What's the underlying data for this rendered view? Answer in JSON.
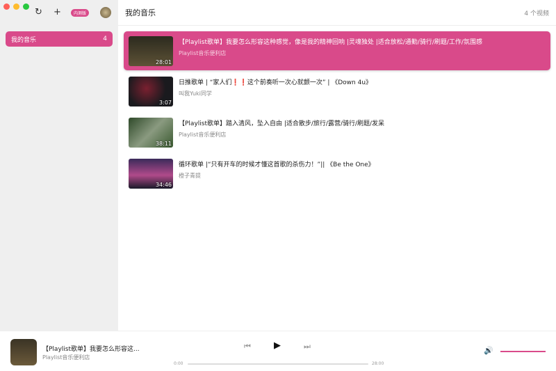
{
  "toolbar": {
    "badge": "内测版",
    "refresh_icon": "↻",
    "add_icon": "+",
    "avatar_icon": "🐱"
  },
  "sidebar": {
    "items": [
      {
        "label": "我的音乐",
        "count": "4"
      }
    ]
  },
  "header": {
    "title": "我的音乐",
    "count": "4 个视频"
  },
  "videos": [
    {
      "title": "【Playlist歌单】我要怎么形容这种感觉，像是我的精神回响 |灵魂独处 |适合放松/通勤/骑行/刷题/工作/氛围感",
      "channel": "Playlist音乐便利店",
      "duration": "28:01",
      "selected": true
    },
    {
      "title": "日推歌单 | “家人们❗❗这个前奏听一次心就颤一次” | 《Down 4u》",
      "channel": "叫我Yuki同学",
      "duration": "3:07"
    },
    {
      "title": "【Playlist歌单】踏入清风，坠入自由 |适合散步/旅行/露营/骑行/刷题/发呆",
      "channel": "Playlist音乐便利店",
      "duration": "38:11"
    },
    {
      "title": "循环歌单 |“只有开车的时候才懂这首歌的杀伤力！”|| 《Be the One》",
      "channel": "橙子青提",
      "duration": "34:46"
    }
  ],
  "player": {
    "title": "【Playlist歌单】我要怎么形容这...",
    "channel": "Playlist音乐便利店",
    "current": "0:00",
    "total": "28:00",
    "progress": 0,
    "volume": 1.0
  },
  "colors": {
    "accent": "#d94a8a"
  }
}
